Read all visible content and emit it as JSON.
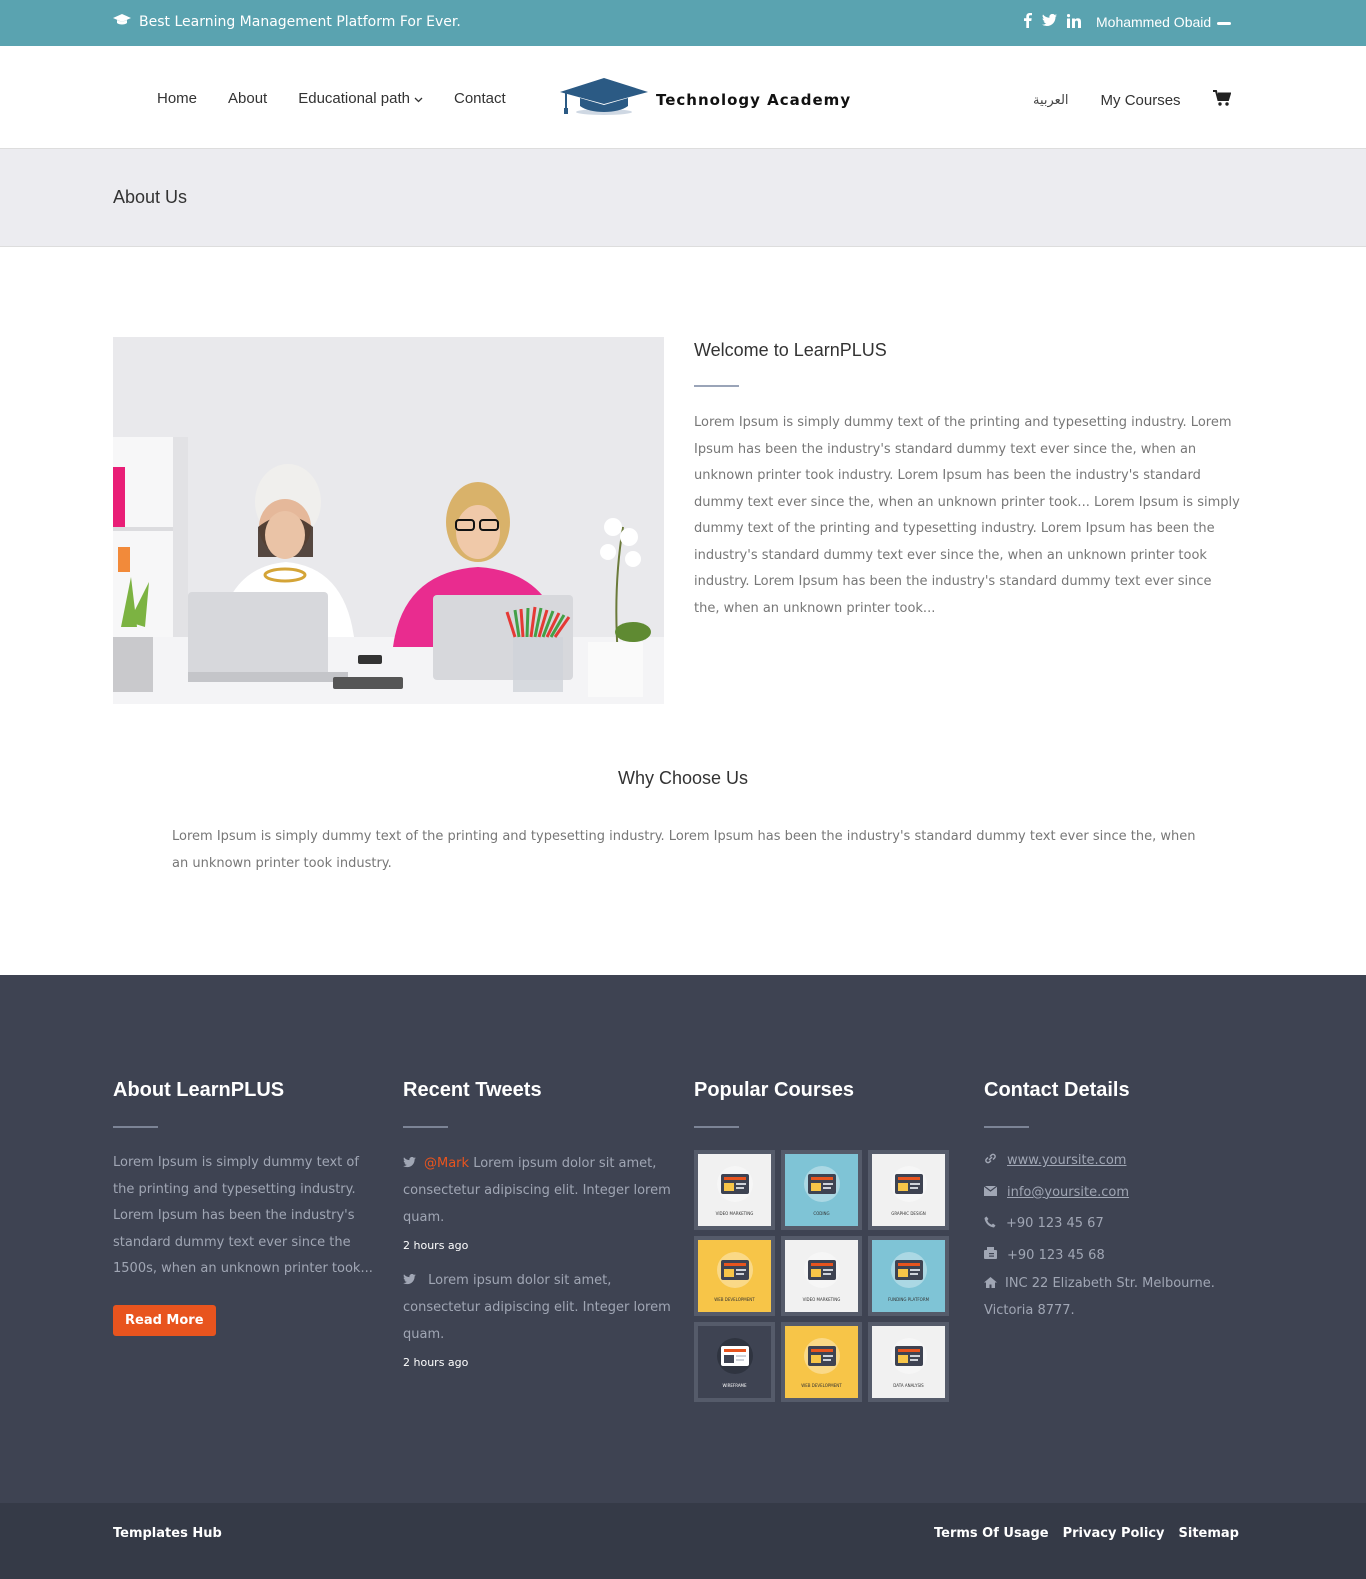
{
  "topbar": {
    "tagline": "Best Learning Management Platform For Ever.",
    "user_name": "Mohammed Obaid",
    "social_icons": [
      "facebook-icon",
      "twitter-icon",
      "linkedin-icon"
    ]
  },
  "nav": {
    "items": [
      {
        "label": "Home"
      },
      {
        "label": "About"
      },
      {
        "label": "Educational path"
      },
      {
        "label": "Contact"
      }
    ],
    "logo_text": "Technology Academy",
    "language": "العربية",
    "my_courses": "My Courses"
  },
  "page_title": "About Us",
  "welcome": {
    "title": "Welcome to LearnPLUS",
    "body": "Lorem Ipsum is simply dummy text of the printing and typesetting industry. Lorem Ipsum has been the industry's standard dummy text ever since the, when an unknown printer took industry. Lorem Ipsum has been the industry's standard dummy text ever since the, when an unknown printer took... Lorem Ipsum is simply dummy text of the printing and typesetting industry. Lorem Ipsum has been the industry's standard dummy text ever since the, when an unknown printer took industry. Lorem Ipsum has been the industry's standard dummy text ever since the, when an unknown printer took..."
  },
  "why": {
    "title": "Why Choose Us",
    "body": "Lorem Ipsum is simply dummy text of the printing and typesetting industry. Lorem Ipsum has been the industry's standard dummy text ever since the, when an unknown printer took industry."
  },
  "footer": {
    "about": {
      "title": "About LearnPLUS",
      "body": "Lorem Ipsum is simply dummy text of the printing and typesetting industry. Lorem Ipsum has been the industry's standard dummy text ever since the 1500s, when an unknown printer took...",
      "button": "Read More"
    },
    "tweets": {
      "title": "Recent Tweets",
      "items": [
        {
          "handle": "@Mark",
          "text": " Lorem ipsum dolor sit amet, consectetur adipiscing elit. Integer lorem quam.",
          "time": "2 hours ago"
        },
        {
          "handle": "",
          "text": " Lorem ipsum dolor sit amet, consectetur adipiscing elit. Integer lorem quam.",
          "time": "2 hours ago"
        }
      ]
    },
    "courses": {
      "title": "Popular Courses",
      "tiles": [
        {
          "label": "VIDEO MARKETING",
          "bg": "#f1f1f1"
        },
        {
          "label": "CODING",
          "bg": "#7fc4d6"
        },
        {
          "label": "GRAPHIC DESIGN",
          "bg": "#f1f1f1"
        },
        {
          "label": "WEB DEVELOPMENT",
          "bg": "#f7c548"
        },
        {
          "label": "VIDEO MARKETING",
          "bg": "#f1f1f1"
        },
        {
          "label": "FUNDING PLATFORM",
          "bg": "#7fc4d6"
        },
        {
          "label": "WIREFRAME",
          "bg": "#3e4352"
        },
        {
          "label": "WEB DEVELOPMENT",
          "bg": "#f7c548"
        },
        {
          "label": "DATA ANALYSIS",
          "bg": "#f1f1f1"
        }
      ]
    },
    "contact": {
      "title": "Contact Details",
      "website": "www.yoursite.com",
      "email": "info@yoursite.com",
      "phone": "+90 123 45 67",
      "fax": "+90 123 45 68",
      "address": "INC 22 Elizabeth Str. Melbourne. Victoria 8777."
    }
  },
  "bottombar": {
    "brand": "Templates Hub",
    "links": [
      "Terms Of Usage",
      "Privacy Policy",
      "Sitemap"
    ]
  },
  "colors": {
    "topbar": "#5aa3b0",
    "footer": "#3e4352",
    "accent": "#e8541e"
  }
}
